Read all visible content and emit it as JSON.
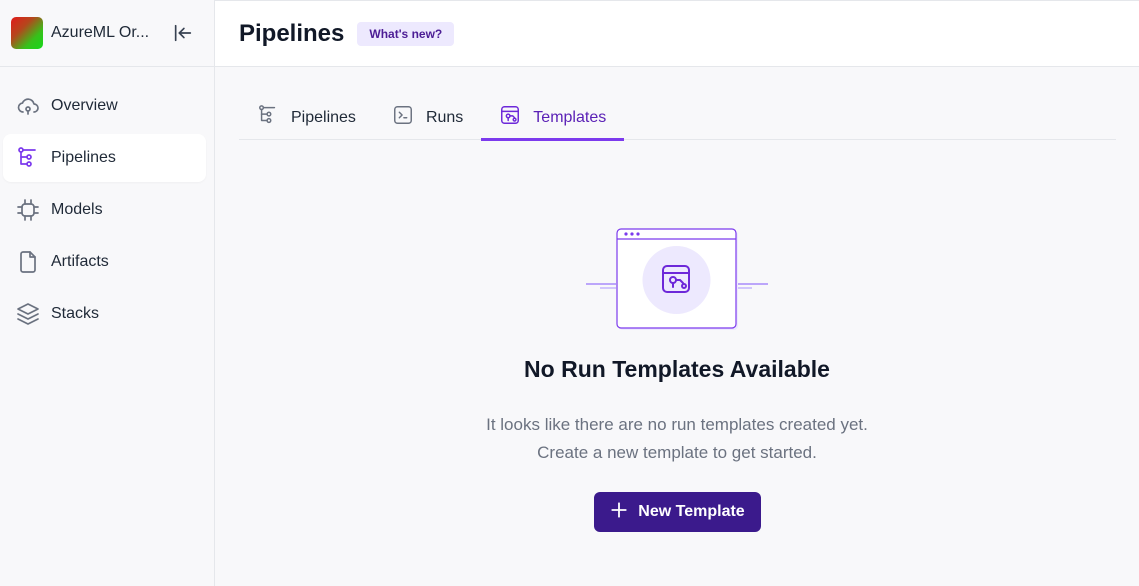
{
  "org": {
    "name": "AzureML Or..."
  },
  "sidebar": {
    "items": [
      {
        "label": "Overview",
        "icon": "cloud-icon"
      },
      {
        "label": "Pipelines",
        "icon": "pipeline-icon",
        "active": true
      },
      {
        "label": "Models",
        "icon": "chip-icon"
      },
      {
        "label": "Artifacts",
        "icon": "file-icon"
      },
      {
        "label": "Stacks",
        "icon": "layers-icon"
      }
    ]
  },
  "header": {
    "title": "Pipelines",
    "badge": "What's new?"
  },
  "tabs": [
    {
      "label": "Pipelines",
      "icon": "pipeline-icon"
    },
    {
      "label": "Runs",
      "icon": "terminal-icon"
    },
    {
      "label": "Templates",
      "icon": "template-icon",
      "active": true
    }
  ],
  "empty_state": {
    "title": "No Run Templates Available",
    "line1": "It looks like there are no run templates created yet.",
    "line2": "Create a new template to get started.",
    "button_label": "New Template"
  },
  "colors": {
    "accent": "#7c3aed",
    "button": "#3b1a8c",
    "badge_bg": "#ede9fe"
  }
}
